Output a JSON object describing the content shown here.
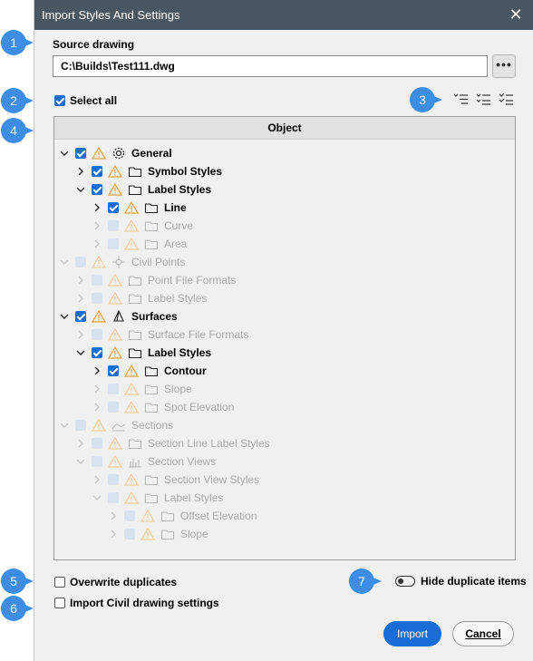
{
  "window": {
    "title": "Import Styles And Settings"
  },
  "source": {
    "label": "Source drawing",
    "path": "C:\\Builds\\Test111.dwg",
    "browse": "•••"
  },
  "select_all": {
    "label": "Select all",
    "checked": true
  },
  "tree": {
    "header": "Object",
    "rows": [
      {
        "label": "General",
        "icon": "gear-icon",
        "state": "on"
      },
      {
        "label": "Symbol Styles",
        "icon": "folder-icon",
        "state": "on"
      },
      {
        "label": "Label Styles",
        "icon": "folder-icon",
        "state": "on"
      },
      {
        "label": "Line",
        "icon": "folder-icon",
        "state": "on"
      },
      {
        "label": "Curve",
        "icon": "folder-icon",
        "state": "dis"
      },
      {
        "label": "Area",
        "icon": "folder-icon",
        "state": "dis"
      },
      {
        "label": "Civil Points",
        "icon": "point-icon",
        "state": "dis"
      },
      {
        "label": "Point File Formats",
        "icon": "folder-icon",
        "state": "dis"
      },
      {
        "label": "Label Styles",
        "icon": "folder-icon",
        "state": "dis"
      },
      {
        "label": "Surfaces",
        "icon": "surface-icon",
        "state": "on"
      },
      {
        "label": "Surface File Formats",
        "icon": "folder-icon",
        "state": "dis"
      },
      {
        "label": "Label Styles",
        "icon": "folder-icon",
        "state": "on"
      },
      {
        "label": "Contour",
        "icon": "folder-icon",
        "state": "on"
      },
      {
        "label": "Slope",
        "icon": "folder-icon",
        "state": "dis"
      },
      {
        "label": "Spot Elevation",
        "icon": "folder-icon",
        "state": "dis"
      },
      {
        "label": "Sections",
        "icon": "sections-icon",
        "state": "dis"
      },
      {
        "label": "Section Line Label Styles",
        "icon": "folder-icon",
        "state": "dis"
      },
      {
        "label": "Section Views",
        "icon": "section-views-icon",
        "state": "dis"
      },
      {
        "label": "Section View Styles",
        "icon": "folder-icon",
        "state": "dis"
      },
      {
        "label": "Label Styles",
        "icon": "folder-icon",
        "state": "dis"
      },
      {
        "label": "Offset Elevation",
        "icon": "folder-icon",
        "state": "dis"
      },
      {
        "label": "Slope",
        "icon": "folder-icon",
        "state": "dis"
      }
    ]
  },
  "options": {
    "overwrite": {
      "label": "Overwrite duplicates",
      "checked": false
    },
    "import_civil": {
      "label": "Import Civil drawing settings",
      "checked": false
    },
    "hide_dup": {
      "label": "Hide duplicate items",
      "on": false
    }
  },
  "buttons": {
    "import": "Import",
    "cancel": "Cancel"
  },
  "callouts": [
    "1",
    "2",
    "3",
    "4",
    "5",
    "6",
    "7"
  ],
  "colors": {
    "accent": "#1a6dd8",
    "callout": "#3d8ce6",
    "titlebar": "#4a5660",
    "warning": "#e6a33a"
  }
}
